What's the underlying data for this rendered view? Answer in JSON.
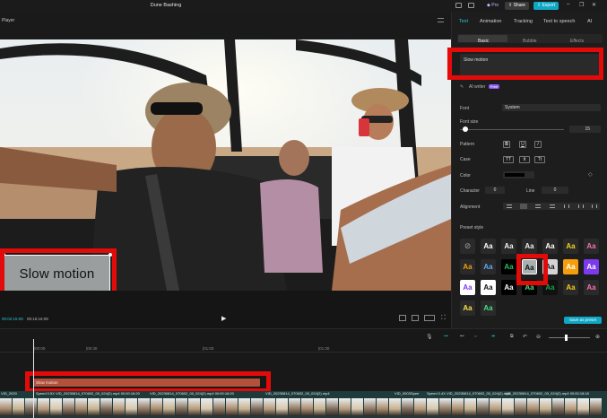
{
  "app": {
    "title": "Dune Bashing",
    "pro_label": "Pro",
    "share_label": "Share",
    "export_label": "Export"
  },
  "player": {
    "label": "Player",
    "current_time": "00:02:15:08",
    "total_time": "00:16:16:08"
  },
  "caption": {
    "text": "Slow motion"
  },
  "panel": {
    "tabs": [
      "Text",
      "Animation",
      "Tracking",
      "Text to speech",
      "AI"
    ],
    "subtabs": [
      "Basic",
      "Bubble",
      "Effects"
    ],
    "text_value": "Slow motion",
    "ai_writer_label": "AI writer",
    "ai_writer_badge": "Free",
    "font_label": "Font",
    "font_value": "System",
    "font_size_label": "Font size",
    "font_size_value": "15",
    "pattern_label": "Pattern",
    "pattern_buttons": [
      "B",
      "U",
      "I"
    ],
    "case_label": "Case",
    "case_buttons": [
      "TT",
      "tt",
      "Tt"
    ],
    "color_label": "Color",
    "character_label": "Character",
    "character_value": "0",
    "line_label": "Line",
    "line_value": "0",
    "alignment_label": "Alignment",
    "preset_label": "Preset style",
    "preset_text": "Aa",
    "save_preset_label": "Save as preset"
  },
  "timeline": {
    "ticks": [
      "|00:00",
      "|00:30",
      "|01:00",
      "|01:30"
    ],
    "text_clip_label": "Slow motion",
    "clips": [
      "VID_2020",
      "Speed 0.5X  VID_20230814_070602_00_024(2).mp4  00:00:16:20",
      "VID_20230814_070602_00_024(2).mp4  00:00:16:20",
      "VID_20230814_070602_00_024(2).mp4",
      "VID_0003",
      "Spee",
      "Speed 0.4X  VID_20230814_070602_00_024(2).mp4",
      "VID_20230814_070602_00_024(2).mp4  00:00:18:18"
    ]
  }
}
